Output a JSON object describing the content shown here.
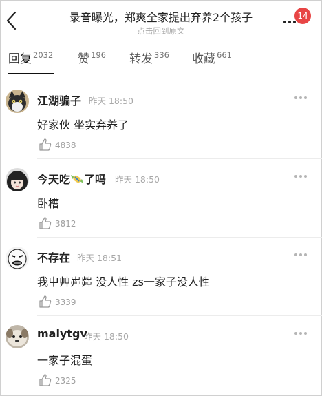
{
  "header": {
    "title": "录音曝光，郑爽全家提出弃养2个孩子",
    "subtitle": "点击回到原文",
    "badge_count": "14",
    "badge_color": "#e84545"
  },
  "tabs": [
    {
      "label": "回复",
      "count": "2032",
      "active": true
    },
    {
      "label": "赞",
      "count": "196",
      "active": false
    },
    {
      "label": "转发",
      "count": "336",
      "active": false
    },
    {
      "label": "收藏",
      "count": "661",
      "active": false
    }
  ],
  "comments": [
    {
      "username": "江湖骗子",
      "time": "昨天 18:50",
      "text": "好家伙 坐实弃养了",
      "likes": "4838",
      "avatar": "cat-avatar"
    },
    {
      "username": "今天吃",
      "username_suffix": "了吗",
      "name_emoji": "candy-icon",
      "time": "昨天 18:50",
      "text": "卧槽",
      "likes": "3812",
      "avatar": "girl-avatar"
    },
    {
      "username": "不存在",
      "time": "昨天 18:51",
      "text": "我屮艸芔茻 没人性 zs一家子没人性",
      "likes": "3339",
      "avatar": "meme-face-avatar"
    },
    {
      "username": "malytgv",
      "time": "昨天 18:50",
      "text": "一家子混蛋",
      "likes": "2325",
      "avatar": "dog-avatar"
    }
  ]
}
